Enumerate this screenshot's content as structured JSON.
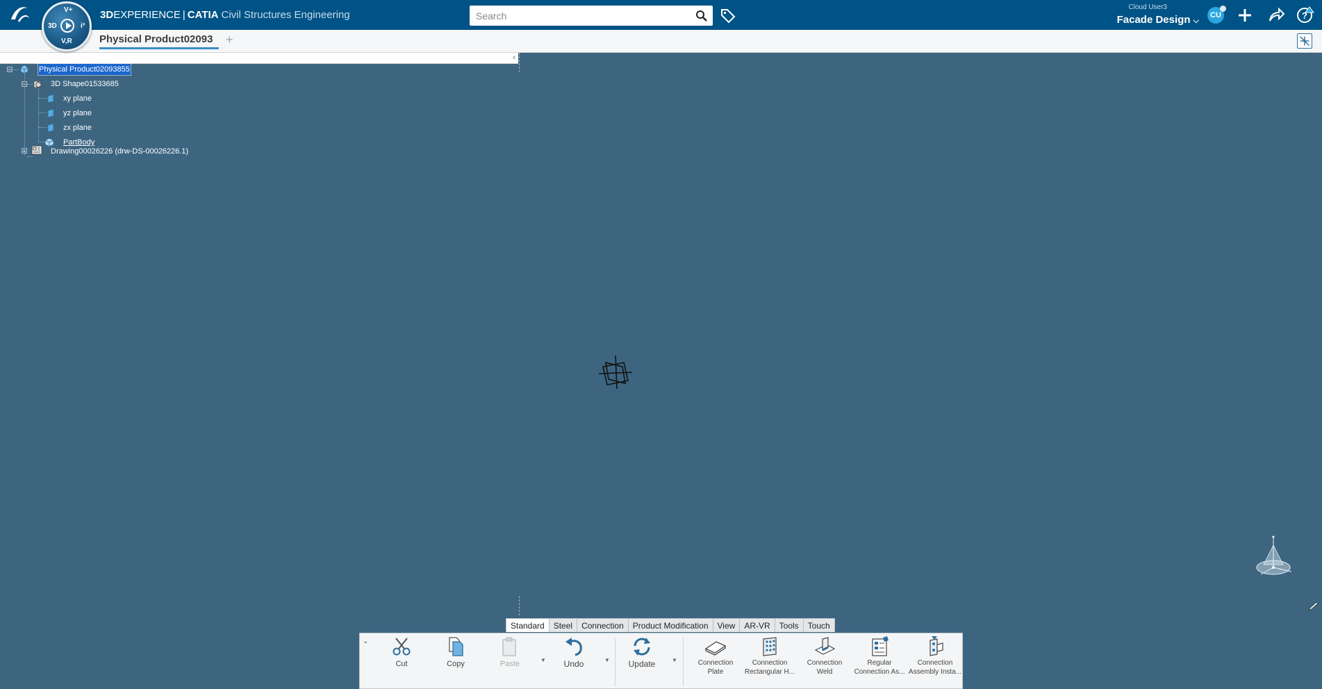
{
  "topbar": {
    "brand": {
      "three_d": "3D",
      "experience": "EXPERIENCE",
      "separator": "|",
      "catia": "CATIA",
      "role": "Civil Structures Engineering"
    },
    "compass": {
      "north": "V+",
      "west": "3D",
      "east": "i³",
      "south": "V,R"
    },
    "search_placeholder": "Search",
    "user": {
      "name": "Cloud User3",
      "space": "Facade Design",
      "initials": "CU"
    },
    "icons": [
      "search-icon",
      "tag-icon",
      "add-icon",
      "share-icon",
      "help-icon"
    ],
    "accent_color": "#005386"
  },
  "tabs": {
    "active": "Physical Product02093",
    "add": "+"
  },
  "tree": {
    "root": "Physical Product02093855",
    "shape": "3D Shape01533685",
    "planes": [
      "xy plane",
      "yz plane",
      "zx plane"
    ],
    "body": "PartBody",
    "drawing": "Drawing00026226 (drw-DS-00026226.1)"
  },
  "section_tabs": [
    "Standard",
    "Steel",
    "Connection",
    "Product Modification",
    "View",
    "AR-VR",
    "Tools",
    "Touch"
  ],
  "active_section": "Standard",
  "commands": {
    "cut": "Cut",
    "copy": "Copy",
    "paste": "Paste",
    "undo": "Undo",
    "update": "Update",
    "plate": [
      "Connection",
      "Plate"
    ],
    "rect": [
      "Connection",
      "Rectangular H..."
    ],
    "weld": [
      "Connection",
      "Weld"
    ],
    "regular": [
      "Regular",
      "Connection As..."
    ],
    "assembly": [
      "Connection",
      "Assembly Insta..."
    ]
  },
  "viewport_color": "#3d6580"
}
